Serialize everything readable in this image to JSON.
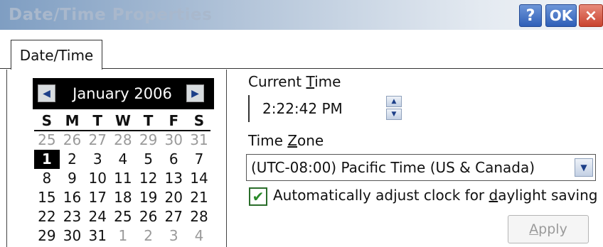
{
  "window": {
    "title": "Date/Time Properties",
    "help_label": "?",
    "ok_label": "OK",
    "close_label": "×"
  },
  "tabs": [
    {
      "label": "Date/Time",
      "active": true
    }
  ],
  "calendar": {
    "month_title": "January 2006",
    "prev_icon": "arrow-left-icon",
    "next_icon": "arrow-right-icon",
    "weekdays": [
      "S",
      "M",
      "T",
      "W",
      "T",
      "F",
      "S"
    ],
    "weeks": [
      [
        {
          "d": "25",
          "other": true
        },
        {
          "d": "26",
          "other": true
        },
        {
          "d": "27",
          "other": true
        },
        {
          "d": "28",
          "other": true
        },
        {
          "d": "29",
          "other": true
        },
        {
          "d": "30",
          "other": true
        },
        {
          "d": "31",
          "other": true
        }
      ],
      [
        {
          "d": "1",
          "selected": true
        },
        {
          "d": "2"
        },
        {
          "d": "3"
        },
        {
          "d": "4"
        },
        {
          "d": "5"
        },
        {
          "d": "6"
        },
        {
          "d": "7"
        }
      ],
      [
        {
          "d": "8"
        },
        {
          "d": "9"
        },
        {
          "d": "10"
        },
        {
          "d": "11"
        },
        {
          "d": "12"
        },
        {
          "d": "13"
        },
        {
          "d": "14"
        }
      ],
      [
        {
          "d": "15"
        },
        {
          "d": "16"
        },
        {
          "d": "17"
        },
        {
          "d": "18"
        },
        {
          "d": "19"
        },
        {
          "d": "20"
        },
        {
          "d": "21"
        }
      ],
      [
        {
          "d": "22"
        },
        {
          "d": "23"
        },
        {
          "d": "24"
        },
        {
          "d": "25"
        },
        {
          "d": "26"
        },
        {
          "d": "27"
        },
        {
          "d": "28"
        }
      ],
      [
        {
          "d": "29"
        },
        {
          "d": "30"
        },
        {
          "d": "31"
        },
        {
          "d": "1",
          "other": true
        },
        {
          "d": "2",
          "other": true
        },
        {
          "d": "3",
          "other": true
        },
        {
          "d": "4",
          "other": true
        }
      ]
    ]
  },
  "current_time": {
    "label_pre": "Current ",
    "label_key": "T",
    "label_post": "ime",
    "value": "2:22:42 PM"
  },
  "time_zone": {
    "label_pre": "Time ",
    "label_key": "Z",
    "label_post": "one",
    "value": "(UTC-08:00) Pacific Time (US & Canada)"
  },
  "dst": {
    "checked": true,
    "label_pre": "Automatically adjust clock for ",
    "label_key": "d",
    "label_post": "aylight saving"
  },
  "apply": {
    "label_key": "A",
    "label_post": "pply",
    "enabled": false
  },
  "colors": {
    "titlebar_start": "#7f9ec2",
    "selected_day": "#000000",
    "other_month_day": "#9a9a9a",
    "check_green": "#2a8a2a"
  }
}
